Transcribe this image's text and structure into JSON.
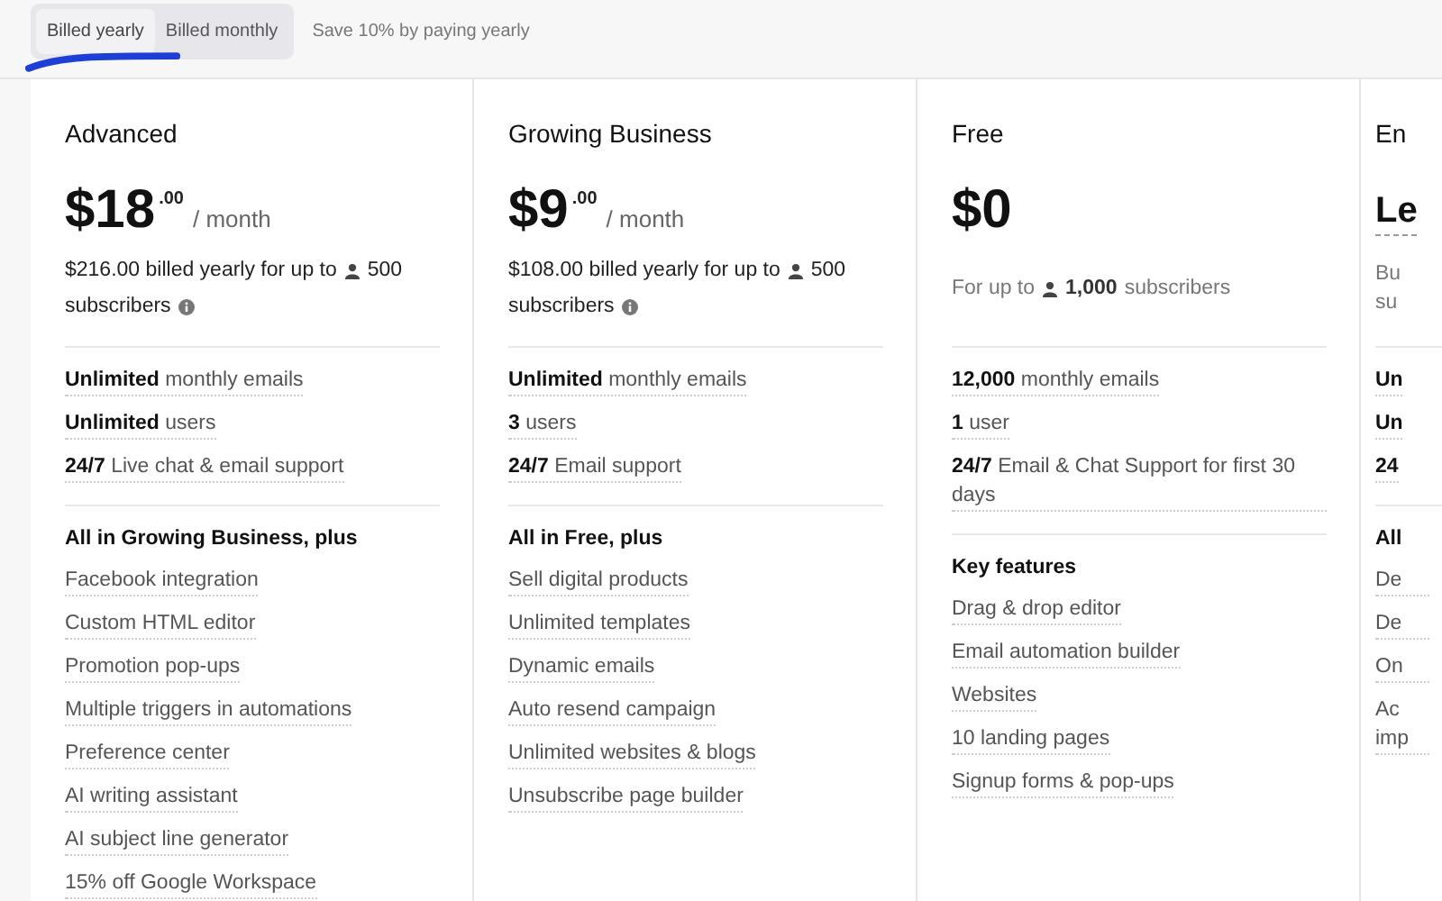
{
  "billing_toggle": {
    "options": [
      {
        "label": "Billed yearly",
        "selected": true
      },
      {
        "label": "Billed monthly",
        "selected": false
      }
    ],
    "note": "Save 10% by paying yearly"
  },
  "plans": [
    {
      "kind": "paid",
      "name": "Advanced",
      "price": {
        "amount": "$18",
        "cents": ".00",
        "period": "/ month"
      },
      "subtitle": {
        "text": "$216.00 billed yearly for up to",
        "count": "500",
        "suffix": "subscribers",
        "info": true
      },
      "limits": [
        "**Unlimited** monthly emails",
        "**Unlimited** users",
        "**24/7** Live chat & email support"
      ],
      "features_heading": "All in Growing Business, plus",
      "features": [
        "Facebook integration",
        "Custom HTML editor",
        "Promotion pop-ups",
        "Multiple triggers in automations",
        "Preference center",
        "AI writing assistant",
        "AI subject line generator",
        "15% off Google Workspace"
      ]
    },
    {
      "kind": "paid",
      "name": "Growing Business",
      "price": {
        "amount": "$9",
        "cents": ".00",
        "period": "/ month"
      },
      "subtitle": {
        "text": "$108.00 billed yearly for up to",
        "count": "500",
        "suffix": "subscribers",
        "info": true
      },
      "limits": [
        "**Unlimited** monthly emails",
        "**3** users",
        "**24/7** Email support"
      ],
      "features_heading": "All in Free, plus",
      "features": [
        "Sell digital products",
        "Unlimited templates",
        "Dynamic emails",
        "Auto resend campaign",
        "Unlimited websites & blogs",
        "Unsubscribe page builder"
      ]
    },
    {
      "kind": "free",
      "name": "Free",
      "price": {
        "amount": "$0"
      },
      "subtitle": {
        "text": "For up to",
        "count": "1,000",
        "suffix": "subscribers",
        "info": false
      },
      "limits": [
        "**12,000** monthly emails",
        "**1** user",
        "**24/7** Email & Chat Support for first 30 days"
      ],
      "features_heading": "Key features",
      "features": [
        "Drag & drop editor",
        "Email automation builder",
        "Websites",
        "10 landing pages",
        "Signup forms & pop-ups"
      ]
    },
    {
      "kind": "cut",
      "name": "En",
      "price": {
        "amount": "Le"
      },
      "subtitle": {
        "text": "Bu su"
      },
      "limits": [
        "Un",
        "Un",
        "24"
      ],
      "features_heading": "All",
      "features": [
        "De",
        "De",
        "On",
        "Ac imp"
      ]
    }
  ]
}
